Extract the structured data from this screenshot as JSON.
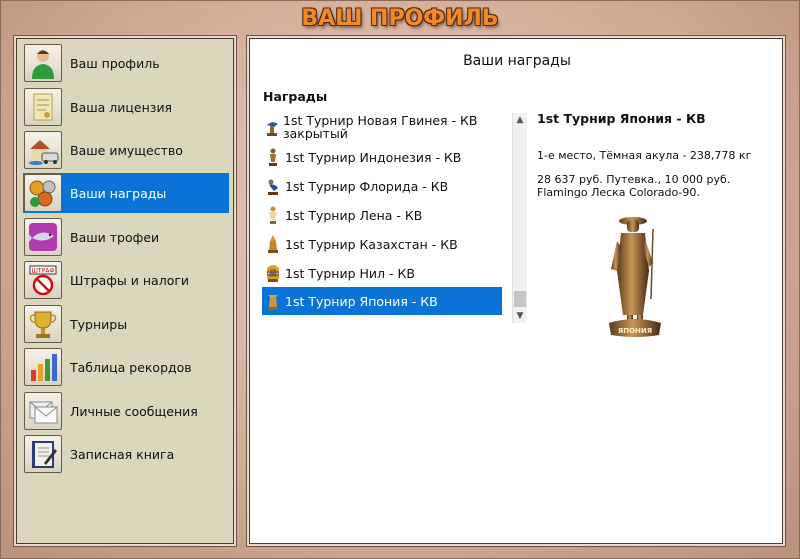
{
  "title": "ВАШ ПРОФИЛЬ",
  "sidebar": {
    "items": [
      {
        "label": "Ваш профиль",
        "icon": "person-icon"
      },
      {
        "label": "Ваша лицензия",
        "icon": "license-icon"
      },
      {
        "label": "Ваше имущество",
        "icon": "property-icon"
      },
      {
        "label": "Ваши награды",
        "icon": "medals-icon",
        "active": true
      },
      {
        "label": "Ваши трофеи",
        "icon": "fish-trophy-icon"
      },
      {
        "label": "Штрафы и налоги",
        "icon": "fines-icon"
      },
      {
        "label": "Турниры",
        "icon": "cup-icon"
      },
      {
        "label": "Таблица рекордов",
        "icon": "records-chart-icon"
      },
      {
        "label": "Личные сообщения",
        "icon": "messages-icon"
      },
      {
        "label": "Записная книга",
        "icon": "notebook-icon"
      }
    ]
  },
  "main": {
    "title": "Ваши награды",
    "awards_heading": "Награды",
    "awards": [
      {
        "label": "1st Турнир Новая Гвинея - КВ закрытый",
        "icon": "award-figure-icon"
      },
      {
        "label": "1st Турнир Индонезия - КВ",
        "icon": "award-figure-icon"
      },
      {
        "label": "1st Турнир Флорида - КВ",
        "icon": "award-figure-icon"
      },
      {
        "label": "1st Турнир Лена - КВ",
        "icon": "award-figure-icon"
      },
      {
        "label": "1st Турнир Казахстан - КВ",
        "icon": "award-figure-icon"
      },
      {
        "label": "1st Турнир Нил - КВ",
        "icon": "pharaoh-icon"
      },
      {
        "label": "1st Турнир Япония - КВ",
        "icon": "samurai-icon",
        "active": true
      }
    ],
    "detail": {
      "title": "1st Турнир Япония - КВ",
      "line1": "1-е место, Тёмная акула - 238,778 кг",
      "line2": "28 637 руб. Путевка., 10 000 руб.",
      "line3": "Flamingo Леска Colorado-90.",
      "statue_label": "ЯПОНИЯ"
    }
  },
  "colors": {
    "accent": "#0a73d6",
    "title_orange": "#f28a2c",
    "sidebar_bg": "#dad7bc"
  }
}
